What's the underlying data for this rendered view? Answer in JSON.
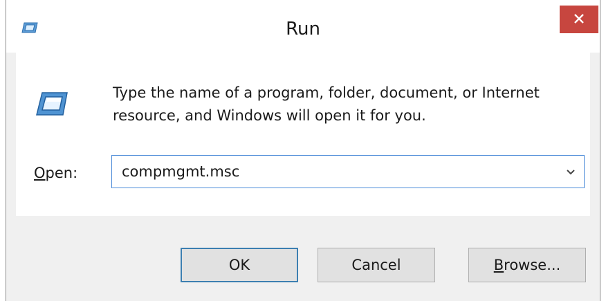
{
  "window": {
    "title": "Run",
    "close_glyph": "✕"
  },
  "icons": {
    "title": "run-icon",
    "main": "run-icon",
    "close": "close-icon",
    "dropdown": "chevron-down-icon"
  },
  "description": "Type the name of a program, folder, document, or Internet resource, and Windows will open it for you.",
  "open_field": {
    "label_accel": "O",
    "label_rest": "pen:",
    "value": "compmgmt.msc"
  },
  "buttons": {
    "ok": "OK",
    "cancel": "Cancel",
    "browse_accel": "B",
    "browse_rest": "rowse..."
  },
  "colors": {
    "close_button": "#c7463f",
    "focus_border": "#4a8ad8",
    "default_button_border": "#3c7fb1"
  }
}
